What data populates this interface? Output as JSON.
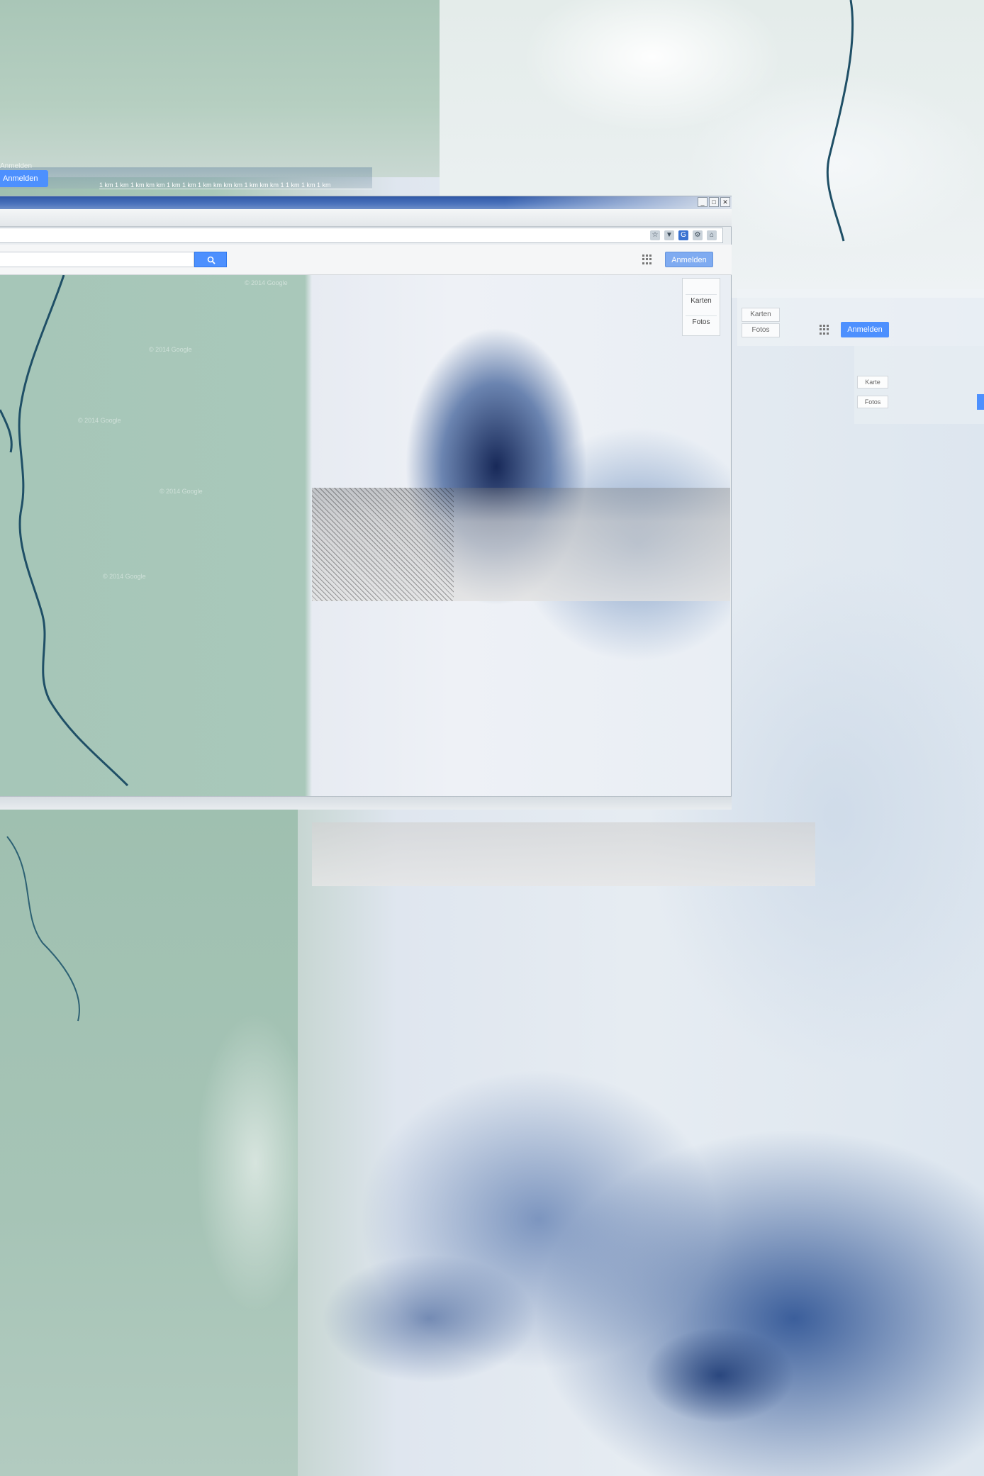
{
  "top": {
    "signin_label": "Anmelden",
    "signin_shadow_label": "Anmelden",
    "scale_labels": "1 km  1 km 1 km km km 1 km   1 km    1 km km km km 1 km km km 1 1 km     1 km     1 km"
  },
  "browser": {
    "window_controls": [
      "_",
      "□",
      "✕"
    ],
    "address_icons": [
      "☆",
      "▼",
      "G",
      "⚙",
      "⌂"
    ],
    "search": {
      "value": "",
      "placeholder": ""
    },
    "signin_label": "Anmelden",
    "map_labels": [
      "© 2014 Google",
      "© 2014 Google",
      "© 2014 Google",
      "© 2014 Google",
      "© 2014 Google"
    ],
    "map_types": {
      "karten": "Karten",
      "fotos": "Fotos"
    }
  },
  "ghost": {
    "karten": "Karten",
    "fotos": "Fotos",
    "signin_label": "Anmelden",
    "karten2": "Karte",
    "fotos2": "Fotos"
  },
  "colors": {
    "accent": "#4d90fe",
    "titlebar": "#2f57a6",
    "ice": "#a6c6b8",
    "ocean": "#1e4b8c"
  }
}
